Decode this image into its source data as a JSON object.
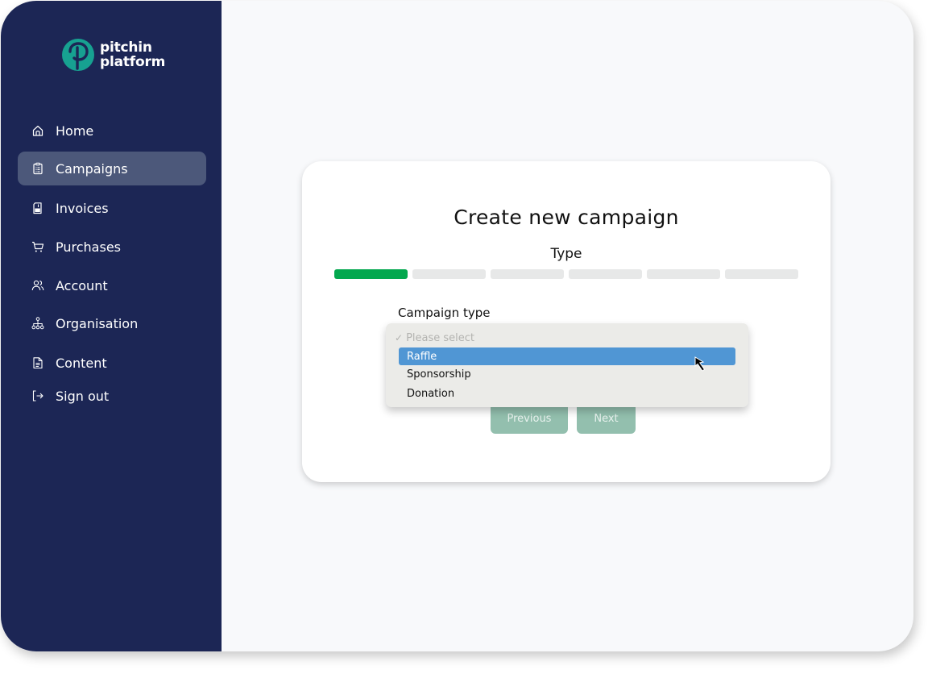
{
  "brand": {
    "name_line1": "pitchin",
    "name_line2": "platform",
    "logo_icon": "pitchin-logo-icon",
    "accent_color": "#17a191",
    "sidebar_color": "#1c2655"
  },
  "sidebar": {
    "items": [
      {
        "label": "Home",
        "icon": "home-icon",
        "active": false
      },
      {
        "label": "Campaigns",
        "icon": "clipboard-icon",
        "active": true
      },
      {
        "label": "Invoices",
        "icon": "invoice-icon",
        "active": false
      },
      {
        "label": "Purchases",
        "icon": "cart-icon",
        "active": false
      },
      {
        "label": "Account",
        "icon": "users-icon",
        "active": false
      },
      {
        "label": "Organisation",
        "icon": "org-chart-icon",
        "active": false
      },
      {
        "label": "Content",
        "icon": "document-icon",
        "active": false
      },
      {
        "label": "Sign out",
        "icon": "sign-out-icon",
        "active": false
      }
    ]
  },
  "wizard": {
    "title": "Create new campaign",
    "step_name": "Type",
    "total_steps": 6,
    "completed_steps": 1,
    "progress_color": "#03a84e",
    "field_label": "Campaign type",
    "dropdown": {
      "placeholder": "Please select",
      "options": [
        "Raffle",
        "Sponsorship",
        "Donation"
      ],
      "highlighted": "Raffle"
    },
    "buttons": {
      "previous": "Previous",
      "next": "Next"
    }
  }
}
